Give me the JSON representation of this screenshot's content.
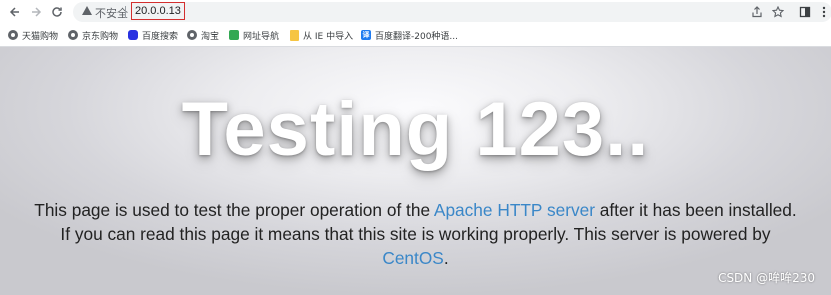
{
  "browser": {
    "security_label": "不安全",
    "url": "20.0.0.13",
    "icons": {
      "back": "arrow-left",
      "forward": "arrow-right",
      "reload": "reload",
      "share": "share",
      "bookmark": "star",
      "sidebar": "side-panel",
      "menu": "kebab"
    }
  },
  "bookmarks": [
    {
      "label": "天猫购物",
      "icon": "globe"
    },
    {
      "label": "京东购物",
      "icon": "globe"
    },
    {
      "label": "百度搜索",
      "icon": "baidu-paw"
    },
    {
      "label": "淘宝",
      "icon": "globe"
    },
    {
      "label": "网址导航",
      "icon": "nav"
    },
    {
      "label": "从 IE 中导入",
      "icon": "folder"
    },
    {
      "label": "百度翻译-200种语...",
      "icon": "fanyi"
    }
  ],
  "page": {
    "headline": "Testing 123..",
    "paragraph": {
      "part1": "This page is used to test the proper operation of the ",
      "link1": "Apache HTTP server",
      "part2": " after it has been installed. If you can read this page it means that this site is working properly. This server is powered by ",
      "link2": "CentOS",
      "part3": "."
    },
    "link_color": "#3a87c8"
  },
  "watermark": "CSDN @哞哞230"
}
